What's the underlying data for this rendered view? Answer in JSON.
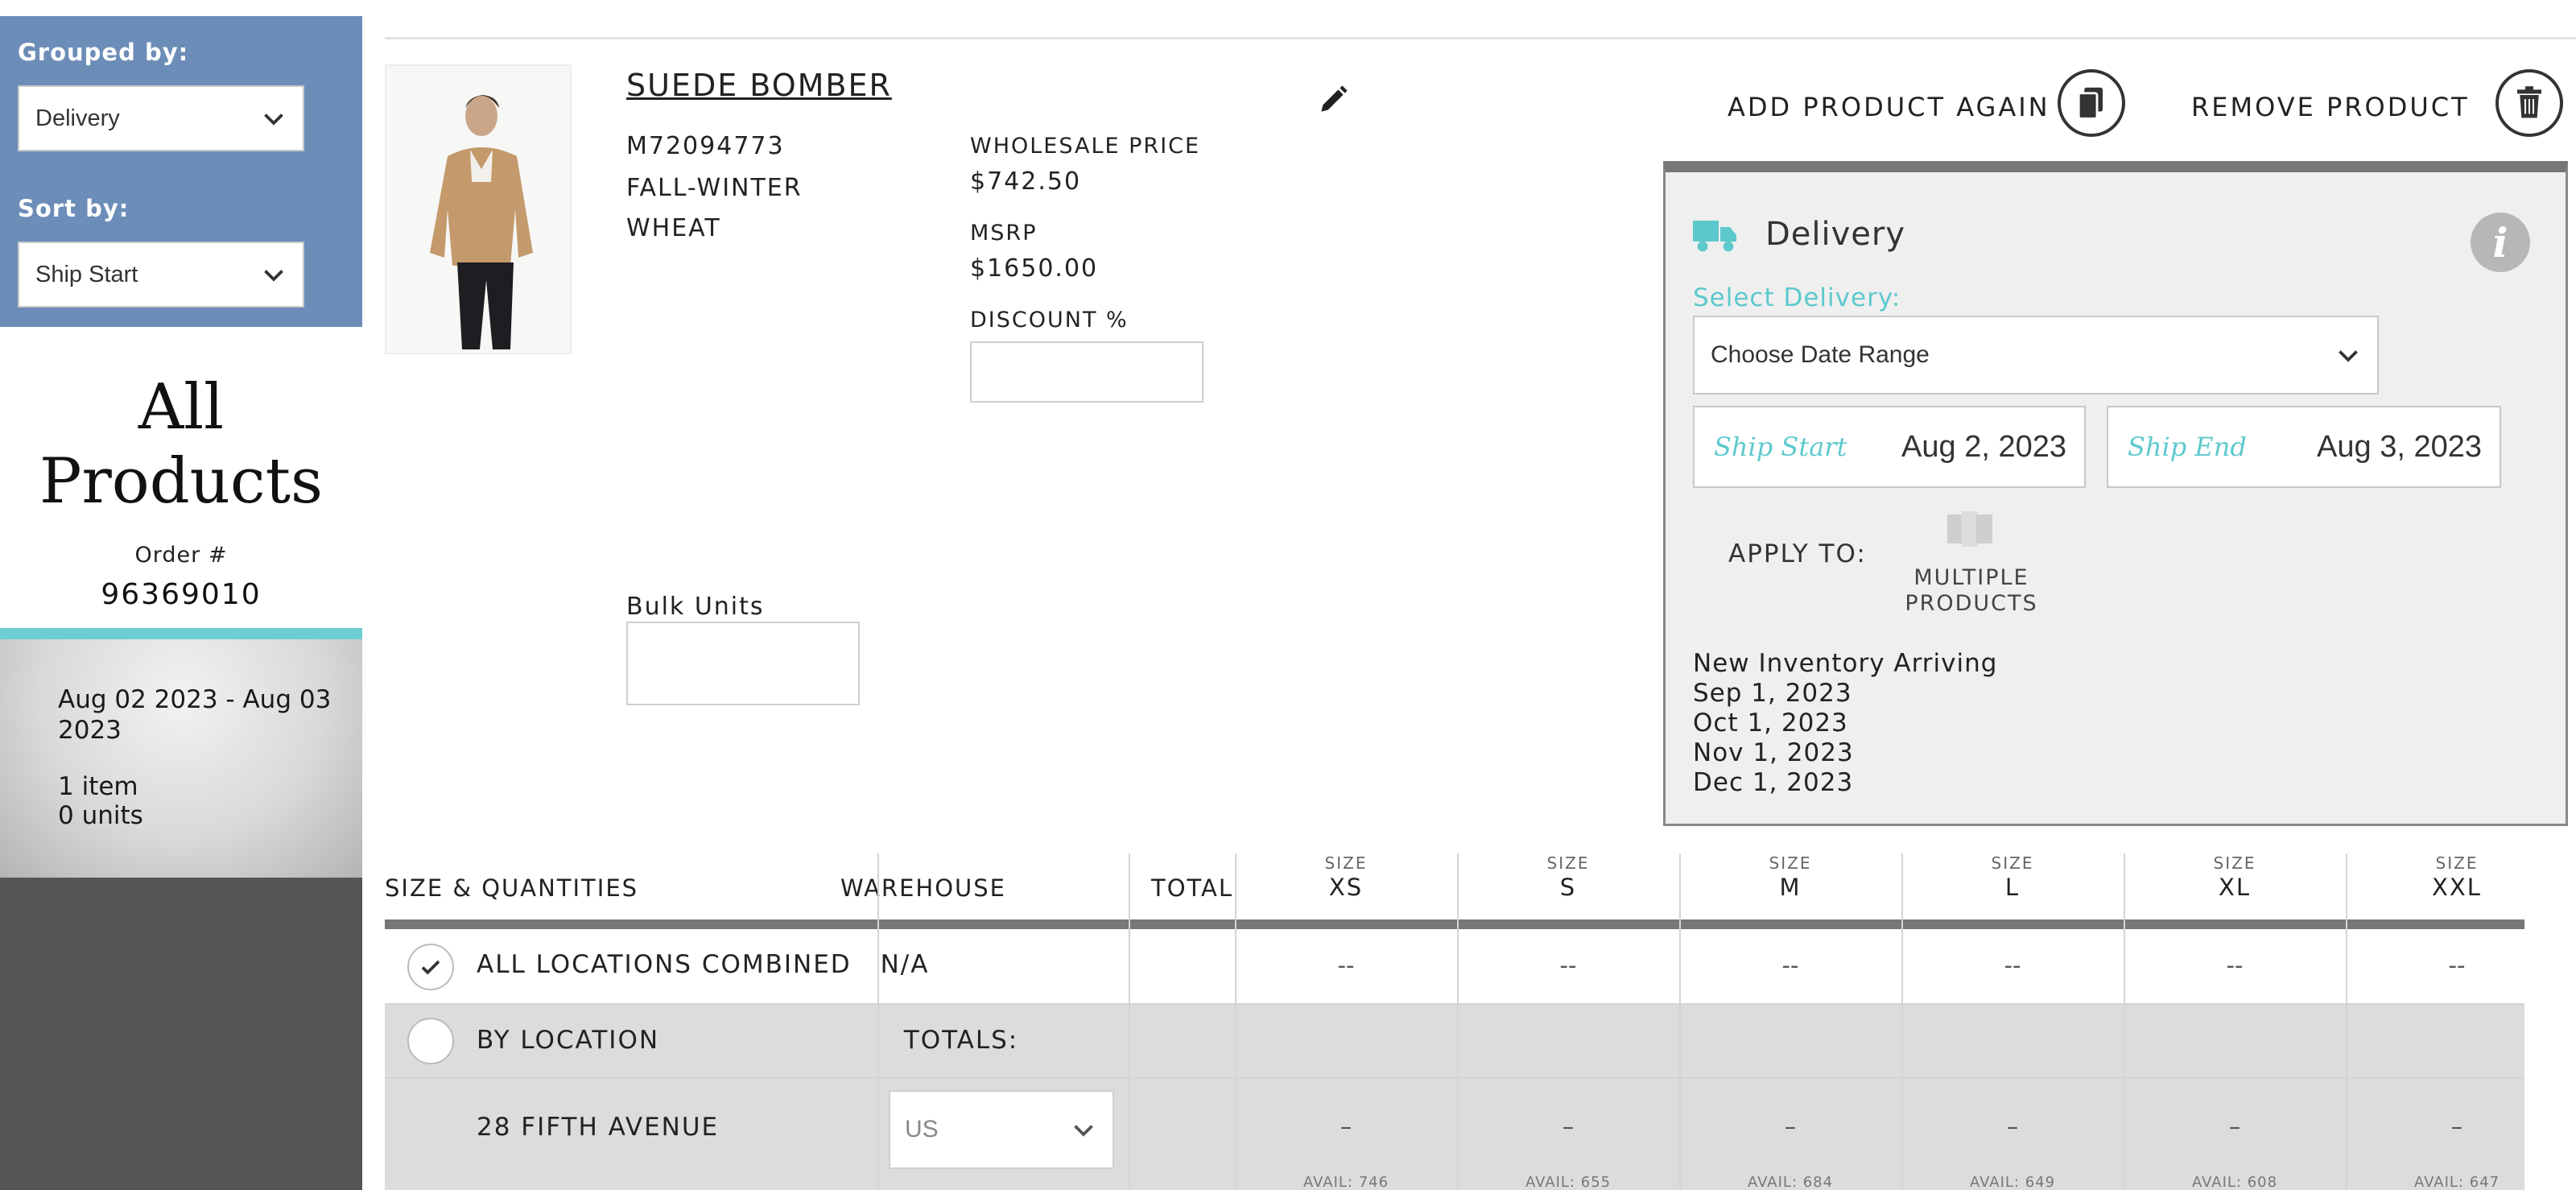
{
  "sidebar": {
    "grouped_by_label": "Grouped by:",
    "grouped_by_value": "Delivery",
    "sort_by_label": "Sort by:",
    "sort_by_value": "Ship Start",
    "title_line1": "All",
    "title_line2": "Products",
    "order_label": "Order #",
    "order_number": "96369010",
    "delivery_group": {
      "dates": "Aug 02 2023 - Aug 03 2023",
      "items": "1 item",
      "units": "0 units"
    }
  },
  "product": {
    "name": "SUEDE BOMBER",
    "style_number": "M72094773",
    "season": "FALL-WINTER",
    "color": "WHEAT",
    "wholesale_label": "WHOLESALE PRICE",
    "wholesale_price": "$742.50",
    "msrp_label": "MSRP",
    "msrp": "$1650.00",
    "discount_label": "DISCOUNT %",
    "discount_value": "",
    "bulk_label": "Bulk Units",
    "bulk_value": "",
    "image_icon": "product-photo-man-in-jacket"
  },
  "actions": {
    "add_again": "ADD PRODUCT AGAIN",
    "add_again_icon": "copy-icon",
    "remove": "REMOVE PRODUCT",
    "remove_icon": "trash-icon",
    "edit_icon": "pencil-icon"
  },
  "delivery": {
    "title": "Delivery",
    "select_label": "Select Delivery:",
    "select_value": "Choose Date Range",
    "ship_start_label": "Ship Start",
    "ship_start_value": "Aug 2, 2023",
    "ship_end_label": "Ship End",
    "ship_end_value": "Aug 3, 2023",
    "apply_to_label": "APPLY TO:",
    "multiple_line1": "MULTIPLE",
    "multiple_line2": "PRODUCTS",
    "inventory_title": "New Inventory Arriving",
    "inventory_dates": [
      "Sep 1, 2023",
      "Oct 1, 2023",
      "Nov 1, 2023",
      "Dec 1, 2023"
    ],
    "accent_color": "#5ec9cd"
  },
  "table": {
    "col_size_qty": "SIZE & QUANTITIES",
    "col_warehouse": "WAREHOUSE",
    "col_total": "TOTAL",
    "size_caption": "SIZE",
    "sizes": [
      "XS",
      "S",
      "M",
      "L",
      "XL",
      "XXL"
    ],
    "row_all": {
      "label": "ALL LOCATIONS COMBINED",
      "warehouse": "N/A",
      "values": [
        "--",
        "--",
        "--",
        "--",
        "--",
        "--"
      ]
    },
    "row_by_location": {
      "label": "BY LOCATION",
      "warehouse": "TOTALS:"
    },
    "row_location": {
      "label": "28 FIFTH AVENUE",
      "warehouse_value": "US",
      "values": [
        "–",
        "–",
        "–",
        "–",
        "–",
        "–"
      ],
      "avail": [
        "AVAIL: 746",
        "AVAIL: 655",
        "AVAIL: 684",
        "AVAIL: 649",
        "AVAIL: 608",
        "AVAIL: 647"
      ]
    }
  }
}
